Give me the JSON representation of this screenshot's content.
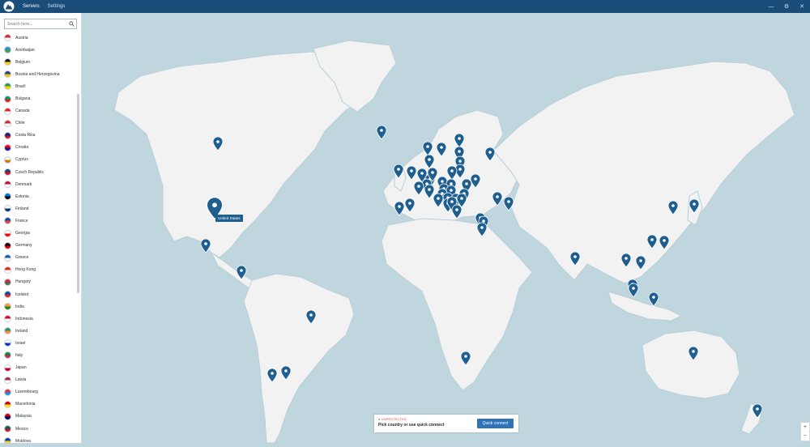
{
  "app": {
    "tabs": [
      {
        "label": "Servers",
        "active": true
      },
      {
        "label": "Settings",
        "active": false
      }
    ],
    "window_controls": [
      "—",
      "⚙",
      "✕"
    ]
  },
  "sidebar": {
    "search_placeholder": "Search here...",
    "countries": [
      {
        "name": "Austria",
        "flag_colors": [
          "#d8232a",
          "#ffffff"
        ]
      },
      {
        "name": "Azerbaijan",
        "flag_colors": [
          "#2a8fd0",
          "#3aa64b"
        ]
      },
      {
        "name": "Belgium",
        "flag_colors": [
          "#1d1d1b",
          "#f7d117"
        ]
      },
      {
        "name": "Bosnia and Herzegovina",
        "flag_colors": [
          "#243d8f",
          "#f4c300"
        ]
      },
      {
        "name": "Brazil",
        "flag_colors": [
          "#229e45",
          "#f7d117"
        ]
      },
      {
        "name": "Bulgaria",
        "flag_colors": [
          "#00966e",
          "#d62612"
        ]
      },
      {
        "name": "Canada",
        "flag_colors": [
          "#e3262b",
          "#ffffff"
        ]
      },
      {
        "name": "Chile",
        "flag_colors": [
          "#d52b1e",
          "#ffffff"
        ]
      },
      {
        "name": "Costa Rica",
        "flag_colors": [
          "#002b7f",
          "#ce1126"
        ]
      },
      {
        "name": "Croatia",
        "flag_colors": [
          "#ff0000",
          "#171796"
        ]
      },
      {
        "name": "Cyprus",
        "flag_colors": [
          "#ffffff",
          "#d57800"
        ]
      },
      {
        "name": "Czech Republic",
        "flag_colors": [
          "#11457e",
          "#d7141a"
        ]
      },
      {
        "name": "Denmark",
        "flag_colors": [
          "#c8102e",
          "#ffffff"
        ]
      },
      {
        "name": "Estonia",
        "flag_colors": [
          "#0072ce",
          "#000000"
        ]
      },
      {
        "name": "Finland",
        "flag_colors": [
          "#ffffff",
          "#003580"
        ]
      },
      {
        "name": "France",
        "flag_colors": [
          "#0055a4",
          "#ef4135"
        ]
      },
      {
        "name": "Georgia",
        "flag_colors": [
          "#ffffff",
          "#ff0000"
        ]
      },
      {
        "name": "Germany",
        "flag_colors": [
          "#000000",
          "#dd0000"
        ]
      },
      {
        "name": "Greece",
        "flag_colors": [
          "#0d5eaf",
          "#ffffff"
        ]
      },
      {
        "name": "Hong Kong",
        "flag_colors": [
          "#de2910",
          "#ffffff"
        ]
      },
      {
        "name": "Hungary",
        "flag_colors": [
          "#cd2a3e",
          "#436f4d"
        ]
      },
      {
        "name": "Iceland",
        "flag_colors": [
          "#02529c",
          "#dc1e35"
        ]
      },
      {
        "name": "India",
        "flag_colors": [
          "#ff9933",
          "#138808"
        ]
      },
      {
        "name": "Indonesia",
        "flag_colors": [
          "#ce1126",
          "#ffffff"
        ]
      },
      {
        "name": "Ireland",
        "flag_colors": [
          "#169b62",
          "#ff883e"
        ]
      },
      {
        "name": "Israel",
        "flag_colors": [
          "#ffffff",
          "#0038b8"
        ]
      },
      {
        "name": "Italy",
        "flag_colors": [
          "#009246",
          "#ce2b37"
        ]
      },
      {
        "name": "Japan",
        "flag_colors": [
          "#ffffff",
          "#bc002d"
        ]
      },
      {
        "name": "Latvia",
        "flag_colors": [
          "#9e3039",
          "#ffffff"
        ]
      },
      {
        "name": "Luxembourg",
        "flag_colors": [
          "#ed2939",
          "#00a1de"
        ]
      },
      {
        "name": "Macedonia",
        "flag_colors": [
          "#d20000",
          "#ffe600"
        ]
      },
      {
        "name": "Malaysia",
        "flag_colors": [
          "#cc0001",
          "#010066"
        ]
      },
      {
        "name": "Mexico",
        "flag_colors": [
          "#006847",
          "#ce1126"
        ]
      },
      {
        "name": "Moldova",
        "flag_colors": [
          "#0046ae",
          "#ffd200"
        ]
      }
    ]
  },
  "map": {
    "land_color": "#f1f2f1",
    "ocean_color": "#bfd6df",
    "pin_color": "#1f5f8f",
    "tooltip_text": "United States",
    "pins": [
      {
        "country": "Canada"
      },
      {
        "country": "United States",
        "highlighted": true
      },
      {
        "country": "Mexico"
      },
      {
        "country": "Costa Rica"
      },
      {
        "country": "Brazil"
      },
      {
        "country": "Chile"
      },
      {
        "country": "Argentina"
      },
      {
        "country": "Iceland"
      },
      {
        "country": "Norway"
      },
      {
        "country": "Sweden"
      },
      {
        "country": "Finland"
      },
      {
        "country": "Estonia"
      },
      {
        "country": "Latvia"
      },
      {
        "country": "Lithuania"
      },
      {
        "country": "Russia"
      },
      {
        "country": "Denmark"
      },
      {
        "country": "Ireland"
      },
      {
        "country": "United Kingdom"
      },
      {
        "country": "Netherlands"
      },
      {
        "country": "Belgium"
      },
      {
        "country": "Luxembourg"
      },
      {
        "country": "Germany"
      },
      {
        "country": "Poland"
      },
      {
        "country": "Czech Republic"
      },
      {
        "country": "Ukraine"
      },
      {
        "country": "Slovakia"
      },
      {
        "country": "France"
      },
      {
        "country": "Switzerland"
      },
      {
        "country": "Austria"
      },
      {
        "country": "Hungary"
      },
      {
        "country": "Romania"
      },
      {
        "country": "Moldova"
      },
      {
        "country": "Slovenia"
      },
      {
        "country": "Croatia"
      },
      {
        "country": "Serbia"
      },
      {
        "country": "Bosnia and Herzegovina"
      },
      {
        "country": "Bulgaria"
      },
      {
        "country": "Italy"
      },
      {
        "country": "Macedonia"
      },
      {
        "country": "Albania"
      },
      {
        "country": "Greece"
      },
      {
        "country": "Portugal"
      },
      {
        "country": "Spain"
      },
      {
        "country": "Turkey"
      },
      {
        "country": "Georgia"
      },
      {
        "country": "Azerbaijan"
      },
      {
        "country": "Cyprus"
      },
      {
        "country": "Israel"
      },
      {
        "country": "South Africa"
      },
      {
        "country": "India"
      },
      {
        "country": "Thailand"
      },
      {
        "country": "Vietnam"
      },
      {
        "country": "Malaysia"
      },
      {
        "country": "Singapore"
      },
      {
        "country": "Indonesia"
      },
      {
        "country": "Hong Kong"
      },
      {
        "country": "Taiwan"
      },
      {
        "country": "South Korea"
      },
      {
        "country": "Japan"
      },
      {
        "country": "Australia"
      },
      {
        "country": "New Zealand"
      }
    ]
  },
  "status": {
    "label": "● UNPROTECTED",
    "prompt": "Pick country or use quick connect",
    "quick_connect_label": "Quick connect"
  },
  "zoom": {
    "in_label": "+",
    "out_label": "−"
  }
}
